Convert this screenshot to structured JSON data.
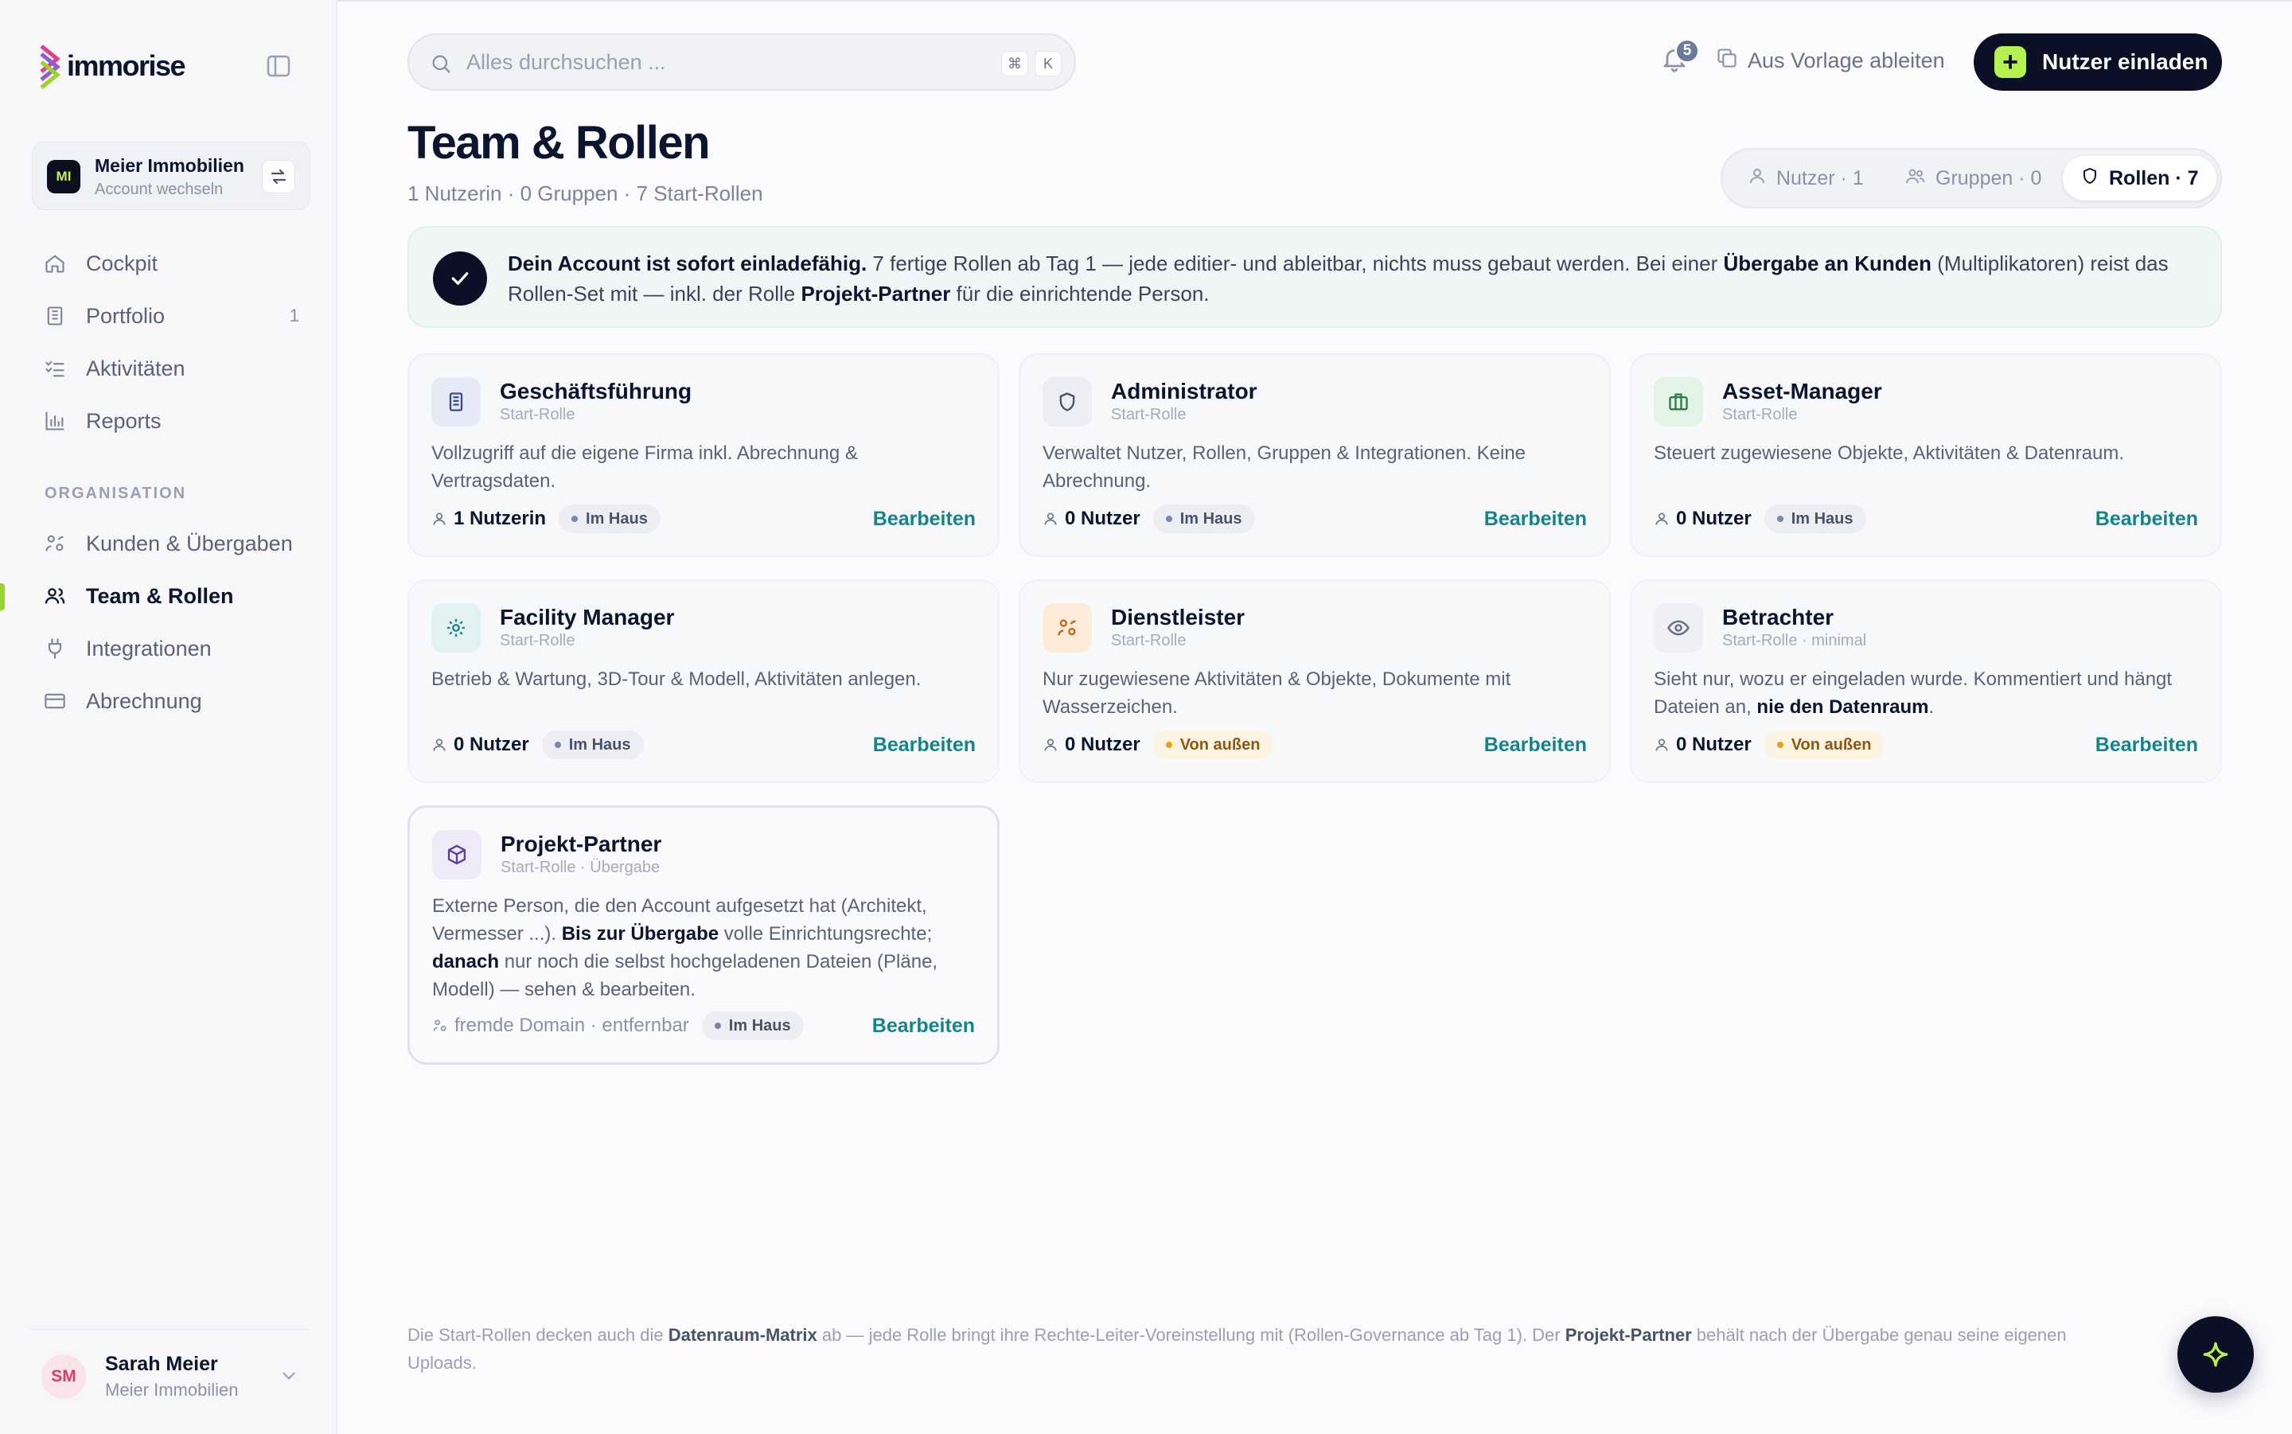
{
  "brand": {
    "name": "immorise"
  },
  "account": {
    "initials": "MI",
    "name": "Meier Immobilien",
    "sub": "Account wechseln"
  },
  "nav": {
    "main": [
      {
        "label": "Cockpit",
        "icon": "home-icon"
      },
      {
        "label": "Portfolio",
        "icon": "building-icon",
        "count": "1"
      },
      {
        "label": "Aktivitäten",
        "icon": "checklist-icon"
      },
      {
        "label": "Reports",
        "icon": "chart-icon"
      }
    ],
    "section_label": "ORGANISATION",
    "org": [
      {
        "label": "Kunden & Übergaben",
        "icon": "handover-icon"
      },
      {
        "label": "Team & Rollen",
        "icon": "team-icon",
        "active": true
      },
      {
        "label": "Integrationen",
        "icon": "plug-icon"
      },
      {
        "label": "Abrechnung",
        "icon": "card-icon"
      }
    ]
  },
  "user": {
    "initials": "SM",
    "name": "Sarah Meier",
    "org": "Meier Immobilien"
  },
  "search": {
    "placeholder": "Alles durchsuchen ...",
    "kbd1": "⌘",
    "kbd2": "K"
  },
  "topbar": {
    "notifications": "5",
    "derive_label": "Aus Vorlage ableiten",
    "invite_label": "Nutzer einladen"
  },
  "header": {
    "title": "Team & Rollen",
    "subtitle": "1 Nutzerin · 0 Gruppen · 7 Start-Rollen"
  },
  "segments": [
    {
      "label": "Nutzer · 1",
      "icon": "user-icon"
    },
    {
      "label": "Gruppen · 0",
      "icon": "users-icon"
    },
    {
      "label": "Rollen · 7",
      "icon": "shield-icon",
      "active": true
    }
  ],
  "banner": {
    "t1": "Dein Account ist sofort einladefähig.",
    "t2": " 7 fertige Rollen ab Tag 1 — jede editier- und ableitbar, nichts muss gebaut werden. Bei einer ",
    "t3": "Übergabe an Kunden",
    "t4": " (Multiplikatoren) reist das Rollen-Set mit — inkl. der Rolle ",
    "t5": "Projekt-Partner",
    "t6": " für die einrichtende Person."
  },
  "roles": [
    {
      "title": "Geschäftsführung",
      "sub": "Start-Rolle",
      "desc": "Vollzugriff auf die eigene Firma inkl. Abrechnung & Vertragsdaten.",
      "users": "1 Nutzerin",
      "scope": "Im Haus",
      "scope_type": "inhouse",
      "edit": "Bearbeiten",
      "icon": "document-icon",
      "icon_bg": "#e6eaf6",
      "icon_color": "#3a4a86"
    },
    {
      "title": "Administrator",
      "sub": "Start-Rolle",
      "desc": "Verwaltet Nutzer, Rollen, Gruppen & Integrationen. Keine Abrechnung.",
      "users": "0 Nutzer",
      "scope": "Im Haus",
      "scope_type": "inhouse",
      "edit": "Bearbeiten",
      "icon": "shield-icon",
      "icon_bg": "#eceef3",
      "icon_color": "#4a5268"
    },
    {
      "title": "Asset-Manager",
      "sub": "Start-Rolle",
      "desc": "Steuert zugewiesene Objekte, Aktivitäten & Datenraum.",
      "users": "0 Nutzer",
      "scope": "Im Haus",
      "scope_type": "inhouse",
      "edit": "Bearbeiten",
      "icon": "briefcase-icon",
      "icon_bg": "#e3f3e6",
      "icon_color": "#2f7a45"
    },
    {
      "title": "Facility Manager",
      "sub": "Start-Rolle",
      "desc": "Betrieb & Wartung, 3D-Tour & Modell, Aktivitäten anlegen.",
      "users": "0 Nutzer",
      "scope": "Im Haus",
      "scope_type": "inhouse",
      "edit": "Bearbeiten",
      "icon": "gear-icon",
      "icon_bg": "#e2f2f1",
      "icon_color": "#1f7f84"
    },
    {
      "title": "Dienstleister",
      "sub": "Start-Rolle",
      "desc": "Nur zugewiesene Aktivitäten & Objekte, Dokumente mit Wasserzeichen.",
      "users": "0 Nutzer",
      "scope": "Von außen",
      "scope_type": "outside",
      "edit": "Bearbeiten",
      "icon": "handover-icon",
      "icon_bg": "#fdebd9",
      "icon_color": "#c0651b"
    },
    {
      "title": "Betrachter",
      "sub": "Start-Rolle · minimal",
      "desc_a": "Sieht nur, wozu er eingeladen wurde. Kommentiert und hängt Dateien an, ",
      "desc_b": "nie den Datenraum",
      "desc_c": ".",
      "users": "0 Nutzer",
      "scope": "Von außen",
      "scope_type": "outside",
      "edit": "Bearbeiten",
      "icon": "eye-icon",
      "icon_bg": "#eef0f3",
      "icon_color": "#6b7285"
    },
    {
      "title": "Projekt-Partner",
      "sub": "Start-Rolle · Übergabe",
      "desc_a": "Externe Person, die den Account aufgesetzt hat (Architekt, Vermesser ...). ",
      "desc_b": "Bis zur Übergabe",
      "desc_c": " volle Einrichtungsrechte; ",
      "desc_d": "danach",
      "desc_e": " nur noch die selbst hochgeladenen Dateien (Pläne, Modell) — sehen & bearbeiten.",
      "users": "fremde Domain · entfernbar",
      "scope": "Im Haus",
      "scope_type": "inhouse",
      "edit": "Bearbeiten",
      "icon": "cube-icon",
      "icon_bg": "#eeeaf7",
      "icon_color": "#5a3fa0"
    }
  ],
  "footer": {
    "a": "Die Start-Rollen decken auch die ",
    "b": "Datenraum-Matrix",
    "c": " ab — jede Rolle bringt ihre Rechte-Leiter-Voreinstellung mit (Rollen-Governance ab Tag 1). Der ",
    "d": "Projekt-Partner",
    "e": " behält nach der Übergabe genau seine eigenen Uploads."
  },
  "colors": {
    "accent": "#14848c",
    "dark": "#0b1026",
    "lime": "#b6f24e"
  }
}
